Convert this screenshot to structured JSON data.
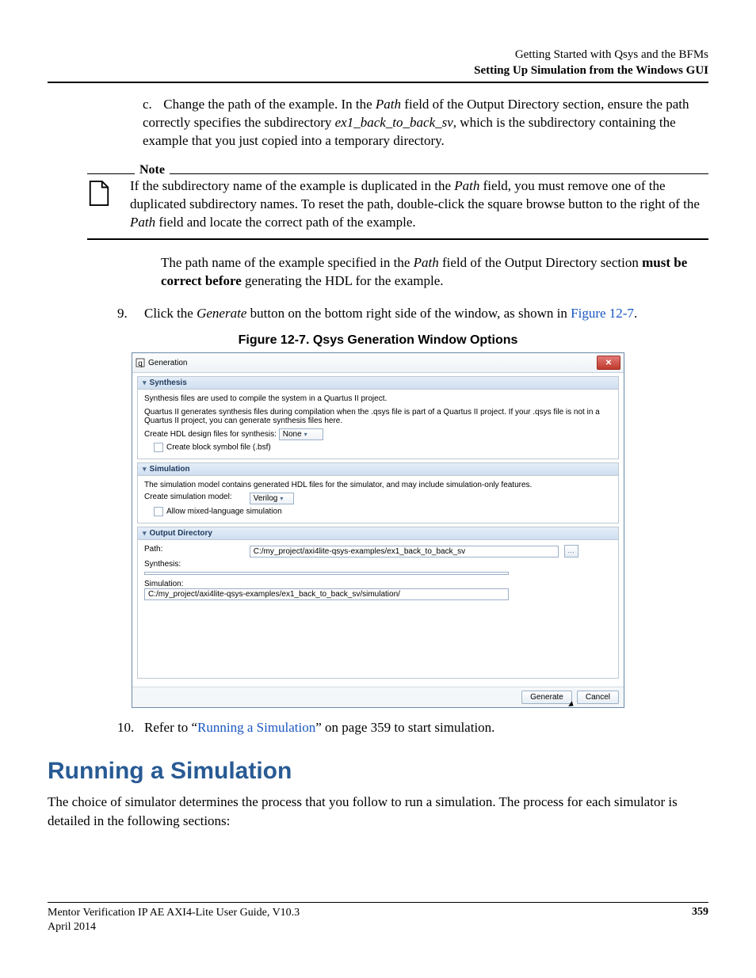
{
  "header": {
    "line1": "Getting Started with Qsys and the BFMs",
    "line2": "Setting Up Simulation from the Windows GUI"
  },
  "step_c": {
    "label": "c.",
    "text_before_path": "Change the path of the example. In the ",
    "path_word": "Path",
    "text_after_path": " field of the Output Directory section, ensure the path correctly specifies the subdirectory ",
    "subdir": "ex1_back_to_back_sv",
    "text_tail": ", which is the subdirectory containing the example that you just copied into a temporary directory."
  },
  "note": {
    "label": "Note",
    "text_parts": {
      "p1": "If the subdirectory name of the example is duplicated in the ",
      "path_word": "Path",
      "p2": " field, you must remove one of the duplicated subdirectory names. To reset the path, double-click the square browse button to the right of the ",
      "path_word2": "Path",
      "p3": " field and locate the correct path of the example."
    }
  },
  "para_after_note": {
    "p1": "The path name of the example specified in the ",
    "path_word": "Path",
    "p2": " field of the Output Directory section ",
    "bold": "must be correct before",
    "p3": " generating the HDL for the example."
  },
  "step_9": {
    "num": "9.",
    "p1": "Click the ",
    "gen": "Generate",
    "p2": " button on the bottom right side of the window, as shown in ",
    "figref": "Figure 12-7",
    "p3": "."
  },
  "figure_label": "Figure 12-7. Qsys Generation Window Options",
  "win": {
    "title": "Generation",
    "close_glyph": "✕",
    "synthesis": {
      "header": "Synthesis",
      "line1": "Synthesis files are used to compile the system in a Quartus II project.",
      "line2": "Quartus II generates synthesis files during compilation when the .qsys file is part of a Quartus II project. If your .qsys file is not in a Quartus II project, you can generate synthesis files here.",
      "hdl_label": "Create HDL design files for synthesis:",
      "hdl_value": "None",
      "bsf_label": "Create block symbol file (.bsf)"
    },
    "simulation": {
      "header": "Simulation",
      "line1": "The simulation model contains generated HDL files for the simulator, and may include simulation-only features.",
      "model_label": "Create simulation model:",
      "model_value": "Verilog",
      "mixed_label": "Allow mixed-language simulation"
    },
    "output": {
      "header": "Output Directory",
      "path_label": "Path:",
      "path_value": "C:/my_project/axi4lite-qsys-examples/ex1_back_to_back_sv",
      "synth_label": "Synthesis:",
      "sim_label": "Simulation:",
      "sim_value": "C:/my_project/axi4lite-qsys-examples/ex1_back_to_back_sv/simulation/"
    },
    "buttons": {
      "generate": "Generate",
      "cancel": "Cancel"
    }
  },
  "step_10": {
    "num": "10.",
    "p1": "Refer to “",
    "link": "Running a Simulation",
    "p2": "” on page 359 to start simulation."
  },
  "h1": "Running a Simulation",
  "body_para": "The choice of simulator determines the process that you follow to run a simulation. The process for each simulator is detailed in the following sections:",
  "footer": {
    "left1": "Mentor Verification IP AE AXI4-Lite User Guide, V10.3",
    "left2": "April 2014",
    "right": "359"
  }
}
